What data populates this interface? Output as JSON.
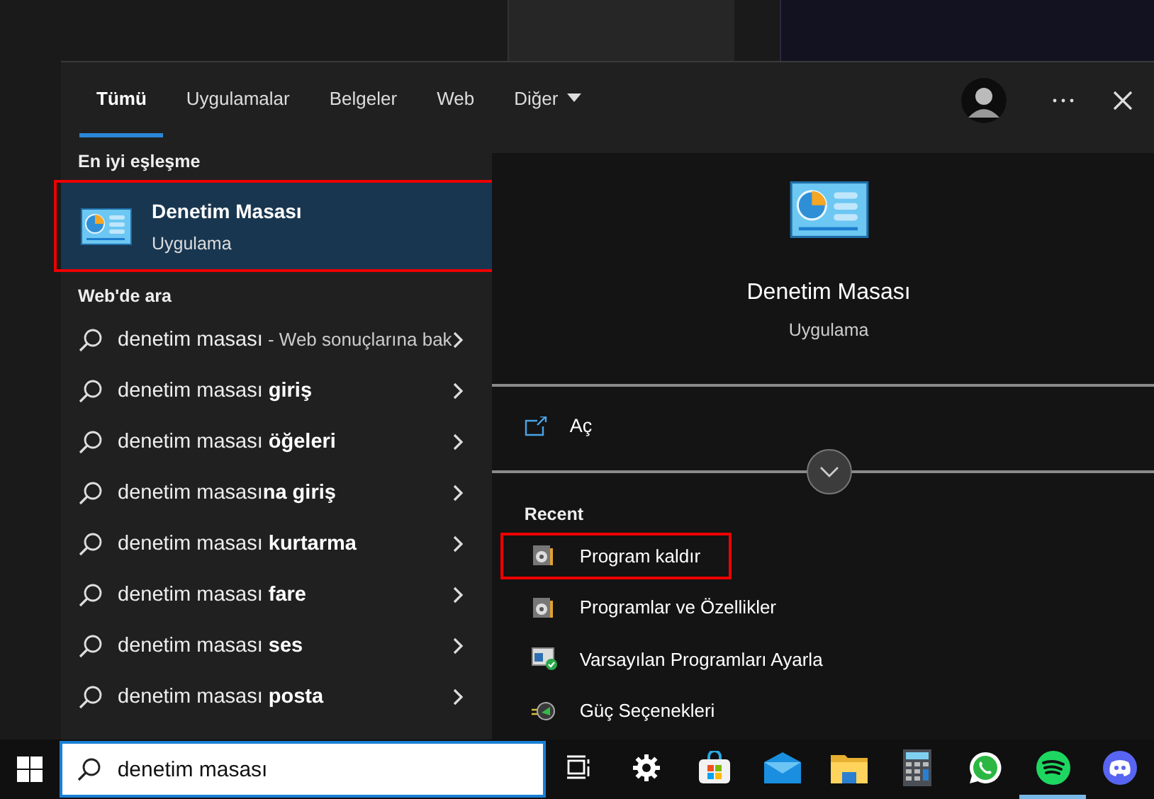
{
  "tabs": [
    {
      "label": "Tümü",
      "selected": true
    },
    {
      "label": "Uygulamalar",
      "selected": false
    },
    {
      "label": "Belgeler",
      "selected": false
    },
    {
      "label": "Web",
      "selected": false
    },
    {
      "label": "Diğer",
      "selected": false,
      "dropdown": true
    }
  ],
  "best_match": {
    "heading": "En iyi eşleşme",
    "title": "Denetim Masası",
    "subtitle": "Uygulama",
    "selected": true,
    "highlighted": true
  },
  "web_search": {
    "heading": "Web'de ara",
    "items": [
      {
        "text": "denetim masası",
        "hint": " - Web sonuçlarına bak"
      },
      {
        "text": "denetim masası **giriş**"
      },
      {
        "text": "denetim masası **öğeleri**"
      },
      {
        "text": "denetim masası**na giriş**"
      },
      {
        "text": "denetim masası **kurtarma**"
      },
      {
        "text": "denetim masası **fare**"
      },
      {
        "text": "denetim masası **ses**"
      },
      {
        "text": "denetim masası **posta**"
      }
    ]
  },
  "preview": {
    "title": "Denetim Masası",
    "subtitle": "Uygulama",
    "actions": [
      {
        "label": "Aç"
      }
    ],
    "recent_heading": "Recent",
    "recent": [
      {
        "label": "Program kaldır",
        "kind": "programs",
        "highlighted": true
      },
      {
        "label": "Programlar ve Özellikler",
        "kind": "programs",
        "highlighted": false
      },
      {
        "label": "Varsayılan Programları Ayarla",
        "kind": "defaults",
        "highlighted": false
      },
      {
        "label": "Güç Seçenekleri",
        "kind": "power",
        "highlighted": false
      }
    ]
  },
  "search_field": {
    "value": "denetim masası"
  },
  "taskbar": [
    {
      "kind": "taskview",
      "running": false
    },
    {
      "kind": "settings",
      "running": false
    },
    {
      "kind": "store",
      "running": false
    },
    {
      "kind": "mail",
      "running": false
    },
    {
      "kind": "folder",
      "running": false
    },
    {
      "kind": "calculator",
      "running": false
    },
    {
      "kind": "whatsapp",
      "running": false
    },
    {
      "kind": "spotify",
      "running": true
    },
    {
      "kind": "discord",
      "running": false
    }
  ]
}
